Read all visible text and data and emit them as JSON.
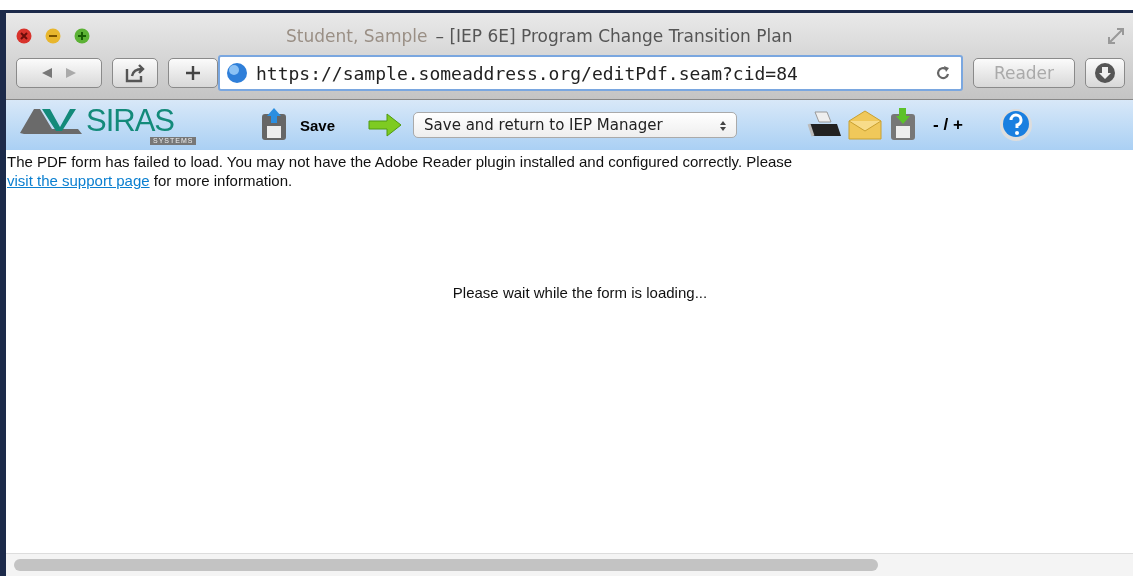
{
  "window": {
    "title_name": "Student, Sample",
    "title_rest": "– [IEP 6E] Program Change Transition Plan"
  },
  "browser_toolbar": {
    "address": "https://sample.someaddress.org/editPdf.seam?cid=84",
    "reader_button": {
      "label": "Reader",
      "disabled": true
    }
  },
  "app_toolbar": {
    "logo": {
      "wordmark": "SIRAS",
      "subtitle": "SYSTEMS"
    },
    "save_label": "Save",
    "action_select": "Save and return to IEP Manager",
    "zoom_label": "- / +"
  },
  "content": {
    "message_before_link": "The PDF form has failed to load. You may not have the Adobe Reader plugin installed and configured correctly. Please",
    "link": "visit the support page",
    "message_after_link": "for more information.",
    "loading": "Please wait while the form is loading..."
  }
}
